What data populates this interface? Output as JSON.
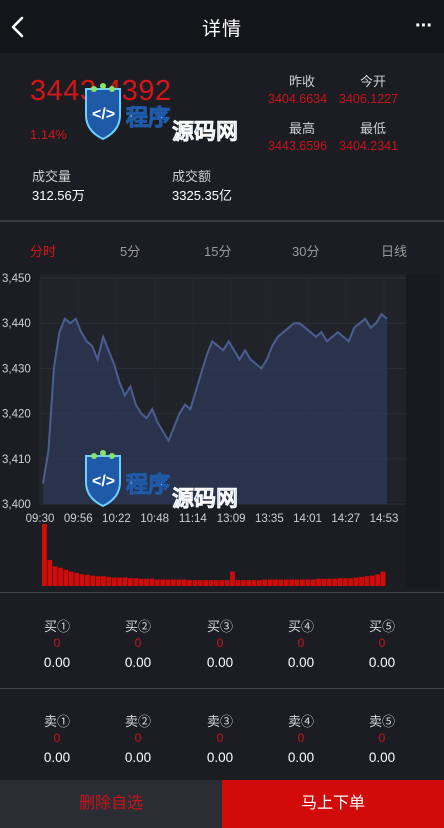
{
  "header": {
    "title": "详情",
    "more_label": "···"
  },
  "quote": {
    "price": "3443.4392",
    "change_pct": "1.14%",
    "stats": [
      {
        "label": "昨收",
        "value": "3404.6634"
      },
      {
        "label": "今开",
        "value": "3406.1227"
      },
      {
        "label": "最高",
        "value": "3443.6596"
      },
      {
        "label": "最低",
        "value": "3404.2341"
      }
    ],
    "volume": {
      "label": "成交量",
      "value": "312.56万"
    },
    "turnover": {
      "label": "成交额",
      "value": "3325.35亿"
    }
  },
  "tabs": [
    {
      "label": "分时",
      "active": true
    },
    {
      "label": "5分",
      "active": false
    },
    {
      "label": "15分",
      "active": false
    },
    {
      "label": "30分",
      "active": false
    },
    {
      "label": "日线",
      "active": false
    }
  ],
  "watermark": {
    "text_a": "程序",
    "text_b": "源码网"
  },
  "colors": {
    "up": "#d4151a",
    "line": "#4a5e8f",
    "volume": "#d10a0a",
    "bg": "#1b1d22"
  },
  "chart_data": {
    "type": "area",
    "ylim": [
      3400,
      3450
    ],
    "yticks": [
      "3,450",
      "3,440",
      "3,430",
      "3,420",
      "3,410",
      "3,400"
    ],
    "xticks": [
      "09:30",
      "09:56",
      "10:22",
      "10:48",
      "11:14",
      "13:09",
      "13:35",
      "14:01",
      "14:27",
      "14:53"
    ],
    "series": [
      {
        "values": [
          3404.5,
          3412,
          3430,
          3438,
          3441,
          3440,
          3441,
          3438,
          3436,
          3435,
          3432,
          3437,
          3434,
          3431,
          3427,
          3424,
          3426,
          3422,
          3420,
          3419,
          3421,
          3418,
          3416,
          3414,
          3417,
          3420,
          3422,
          3421,
          3425,
          3429,
          3433,
          3436,
          3435,
          3434,
          3436,
          3434,
          3432,
          3434,
          3432,
          3431,
          3430,
          3432,
          3435,
          3437,
          3438,
          3439,
          3440,
          3440,
          3439,
          3438,
          3437,
          3438,
          3436,
          3437,
          3438,
          3437,
          3436,
          3439,
          3440,
          3441,
          3439,
          3440,
          3442,
          3441
        ]
      },
      {
        "name": "volume",
        "values": [
          95,
          40,
          30,
          28,
          25,
          22,
          20,
          18,
          17,
          16,
          15,
          15,
          14,
          13,
          13,
          13,
          12,
          12,
          11,
          11,
          11,
          10,
          10,
          10,
          10,
          10,
          10,
          9,
          9,
          9,
          9,
          9,
          9,
          9,
          9,
          22,
          9,
          9,
          9,
          9,
          9,
          10,
          10,
          10,
          10,
          10,
          10,
          10,
          10,
          10,
          10,
          11,
          11,
          11,
          11,
          12,
          12,
          12,
          13,
          14,
          15,
          16,
          18,
          22
        ]
      }
    ]
  },
  "orderbook": {
    "buy": [
      {
        "label": "买①",
        "qty": "0",
        "price": "0.00"
      },
      {
        "label": "买②",
        "qty": "0",
        "price": "0.00"
      },
      {
        "label": "买③",
        "qty": "0",
        "price": "0.00"
      },
      {
        "label": "买④",
        "qty": "0",
        "price": "0.00"
      },
      {
        "label": "买⑤",
        "qty": "0",
        "price": "0.00"
      }
    ],
    "sell": [
      {
        "label": "卖①",
        "qty": "0",
        "price": "0.00"
      },
      {
        "label": "卖②",
        "qty": "0",
        "price": "0.00"
      },
      {
        "label": "卖③",
        "qty": "0",
        "price": "0.00"
      },
      {
        "label": "卖④",
        "qty": "0",
        "price": "0.00"
      },
      {
        "label": "卖⑤",
        "qty": "0",
        "price": "0.00"
      }
    ]
  },
  "actions": {
    "remove_watchlist": "删除自选",
    "order_now": "马上下单"
  }
}
